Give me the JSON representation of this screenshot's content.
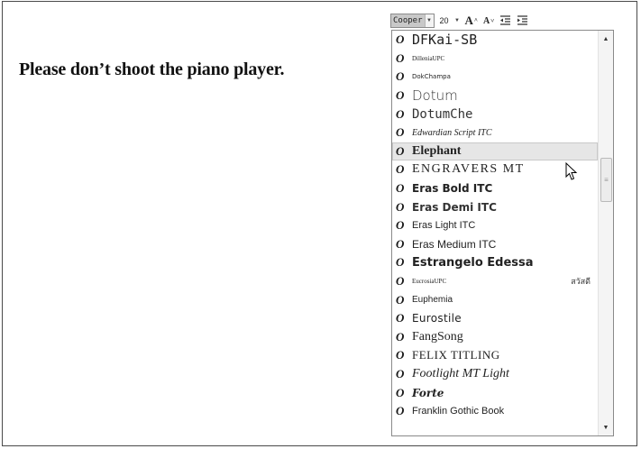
{
  "document": {
    "text": "Please don’t shoot the piano player."
  },
  "toolbar": {
    "font_name": "Cooper",
    "font_size": "20",
    "grow_label": "A",
    "shrink_label": "A",
    "grow_marker": "^",
    "shrink_marker": "˅",
    "decrease_indent_icon": "decrease-indent-icon",
    "increase_indent_icon": "increase-indent-icon"
  },
  "font_list": {
    "hovered_index": 6,
    "items": [
      {
        "name": "DFKai-SB"
      },
      {
        "name": "DilleniaUPC"
      },
      {
        "name": "DokChampa"
      },
      {
        "name": "Dotum"
      },
      {
        "name": "DotumChe"
      },
      {
        "name": "Edwardian Script ITC"
      },
      {
        "name": "Elephant"
      },
      {
        "name": "ENGRAVERS MT"
      },
      {
        "name": "Eras Bold ITC"
      },
      {
        "name": "Eras Demi ITC"
      },
      {
        "name": "Eras Light ITC"
      },
      {
        "name": "Eras Medium ITC"
      },
      {
        "name": "Estrangelo Edessa"
      },
      {
        "name": "EucrosiaUPC",
        "sample": "สวัสดี"
      },
      {
        "name": "Euphemia"
      },
      {
        "name": "Eurostile"
      },
      {
        "name": "FangSong"
      },
      {
        "name": "FELIX TITLING"
      },
      {
        "name": "Footlight MT Light"
      },
      {
        "name": "Forte"
      },
      {
        "name": "Franklin Gothic Book"
      }
    ]
  },
  "icons": {
    "font_type": "opentype-font-icon",
    "dropdown_arrow": "chevron-down-icon",
    "scroll_up": "scroll-up-arrow-icon",
    "scroll_down": "scroll-down-arrow-icon",
    "cursor": "mouse-pointer-icon"
  }
}
